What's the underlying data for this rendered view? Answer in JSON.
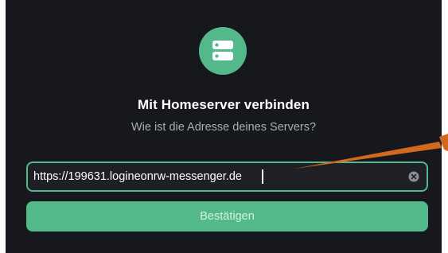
{
  "dialog": {
    "icon": "server-icon",
    "title": "Mit Homeserver verbinden",
    "subtitle": "Wie ist die Adresse deines Servers?",
    "server_input": {
      "value": "https://199631.logineonrw-messenger.de",
      "clear_icon": "clear-circle-icon"
    },
    "confirm_label": "Bestätigen"
  },
  "colors": {
    "accent": "#53b98b",
    "background": "#16181d",
    "annotation_arrow": "#d2691e"
  }
}
